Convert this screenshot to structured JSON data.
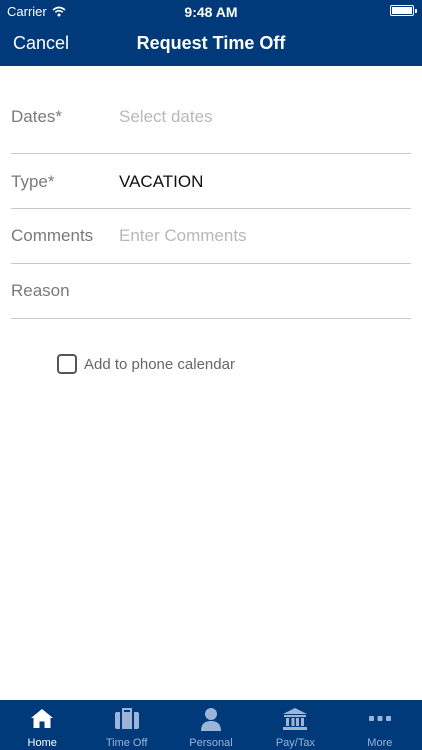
{
  "status_bar": {
    "carrier": "Carrier",
    "time": "9:48 AM"
  },
  "header": {
    "cancel_label": "Cancel",
    "title": "Request Time Off"
  },
  "form": {
    "dates": {
      "label": "Dates*",
      "placeholder": "Select dates"
    },
    "type": {
      "label": "Type*",
      "value": "VACATION"
    },
    "comments": {
      "label": "Comments",
      "placeholder": "Enter Comments"
    },
    "reason": {
      "label": "Reason"
    }
  },
  "calendar_option": {
    "label": "Add to phone calendar",
    "checked": false
  },
  "tabbar": {
    "items": [
      {
        "label": "Home",
        "icon": "home-icon",
        "active": true
      },
      {
        "label": "Time Off",
        "icon": "suitcase-icon",
        "active": false
      },
      {
        "label": "Personal",
        "icon": "person-icon",
        "active": false
      },
      {
        "label": "Pay/Tax",
        "icon": "bank-icon",
        "active": false
      },
      {
        "label": "More",
        "icon": "more-icon",
        "active": false
      }
    ]
  },
  "colors": {
    "brand": "#003a7a",
    "tab_inactive": "#9cb4d8",
    "placeholder": "#b8b8b8"
  }
}
